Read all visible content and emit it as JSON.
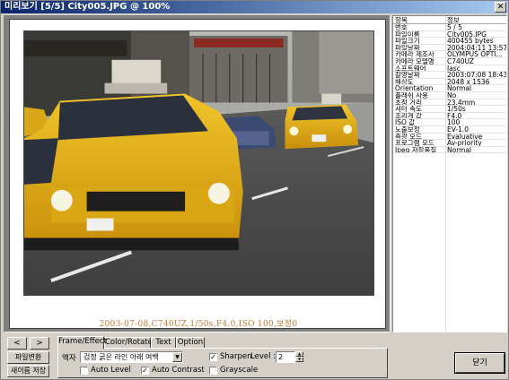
{
  "window": {
    "title": "미리보기 [5/5] City005.JPG @ 100%",
    "close_glyph": "✕"
  },
  "preview": {
    "caption": "2003-07-08,C740UZ,1/50s,F4.0,ISO 100,보정0"
  },
  "info": {
    "header": {
      "key": "항목",
      "value": "정보"
    },
    "rows": [
      {
        "key": "번호",
        "value": "5 / 5"
      },
      {
        "key": "파일이름",
        "value": "City005.JPG"
      },
      {
        "key": "파일크기",
        "value": "400455 bytes"
      },
      {
        "key": "파일날짜",
        "value": "2004:04:11 13:57:52"
      },
      {
        "key": "카메라 제조사",
        "value": "OLYMPUS OPTI..."
      },
      {
        "key": "카메라 모델명",
        "value": "C740UZ"
      },
      {
        "key": "소프트웨어",
        "value": "Jasc"
      },
      {
        "key": "촬영날짜",
        "value": "2003:07:08 18:43:50"
      },
      {
        "key": "해상도",
        "value": "2048 x 1536"
      },
      {
        "key": "Orientation",
        "value": "Normal"
      },
      {
        "key": "플래쉬 사용",
        "value": "No"
      },
      {
        "key": "초점 거리",
        "value": "23.4mm"
      },
      {
        "key": "셔터 속도",
        "value": "1/50s"
      },
      {
        "key": "조리개 값",
        "value": "F4.0"
      },
      {
        "key": "ISO 값",
        "value": "100"
      },
      {
        "key": "노출보정",
        "value": "EV-1.0"
      },
      {
        "key": "측광 모드",
        "value": "Evaluative"
      },
      {
        "key": "프로그램 모드",
        "value": "Av-priority"
      },
      {
        "key": "Jpeg 저장품질",
        "value": "Normal"
      }
    ]
  },
  "nav": {
    "prev_glyph": "<",
    "next_glyph": ">",
    "rename_label": "파일변환",
    "save_as_label": "새이름 저장"
  },
  "tabs": [
    {
      "label": "Frame/Effect",
      "active": true
    },
    {
      "label": "Color/Rotate",
      "active": false
    },
    {
      "label": "Text",
      "active": false
    },
    {
      "label": "Option",
      "active": false
    }
  ],
  "frame_effect": {
    "frame_label": "액자",
    "frame_value": "검정 굵은 라인 아래 여백",
    "sharpen": {
      "label": "Sharpen",
      "checked": true
    },
    "level_label": "Level :",
    "level_value": "2",
    "auto_level": {
      "label": "Auto Level",
      "checked": false
    },
    "auto_contrast": {
      "label": "Auto Contrast",
      "checked": true
    },
    "grayscale": {
      "label": "Grayscale",
      "checked": false
    }
  },
  "close_button": "닫기"
}
